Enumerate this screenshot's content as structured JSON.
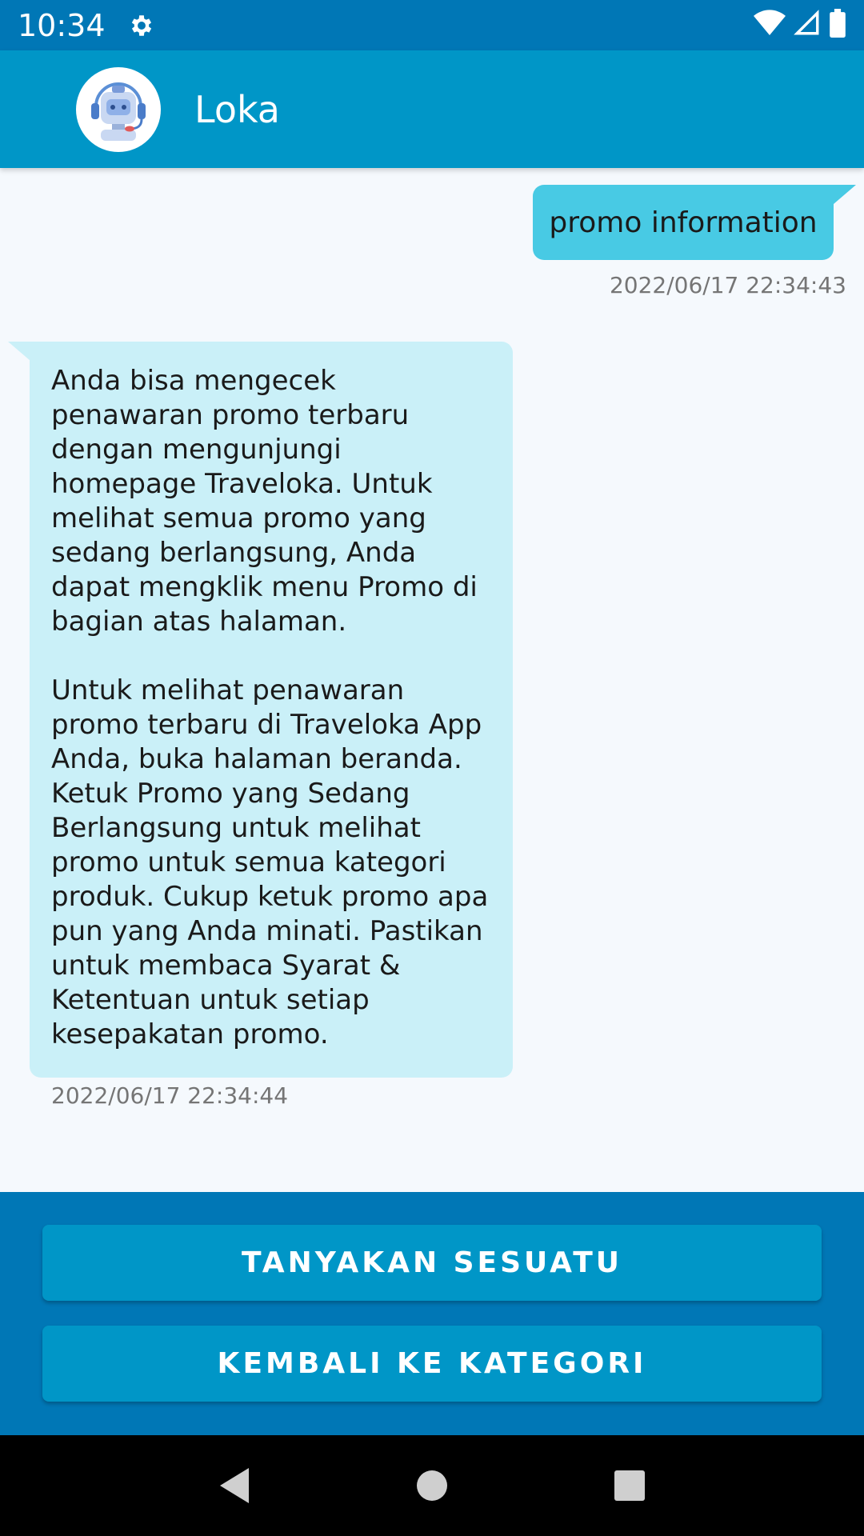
{
  "status_bar": {
    "time": "10:34",
    "icons": [
      "gear-icon",
      "wifi-icon",
      "cell-signal-icon",
      "battery-icon"
    ]
  },
  "app_bar": {
    "title": "Loka",
    "avatar_icon": "robot-icon"
  },
  "chat": {
    "messages": [
      {
        "sender": "user",
        "text": "promo information",
        "timestamp": "2022/06/17 22:34:43"
      },
      {
        "sender": "bot",
        "text": "Anda bisa mengecek penawaran promo terbaru dengan mengunjungi homepage Traveloka. Untuk melihat semua promo yang sedang berlangsung, Anda dapat mengklik menu Promo di bagian atas halaman.\n\nUntuk melihat penawaran promo terbaru di Traveloka App Anda, buka halaman beranda. Ketuk Promo yang Sedang Berlangsung untuk melihat promo untuk semua kategori produk. Cukup ketuk promo apa pun yang Anda minati. Pastikan untuk membaca Syarat & Ketentuan untuk setiap kesepakatan promo.",
        "timestamp": "2022/06/17 22:34:44"
      }
    ]
  },
  "actions": {
    "ask_label": "TANYAKAN SESUATU",
    "back_label": "KEMBALI KE KATEGORI"
  },
  "nav_bar": {
    "icons": [
      "back-icon",
      "home-icon",
      "recents-icon"
    ]
  },
  "colors": {
    "status_bar": "#0077b6",
    "app_bar": "#0096c7",
    "user_bubble": "#48cae4",
    "bot_bubble": "#caf0f8",
    "panel": "#0077b6",
    "button": "#0096c7"
  }
}
